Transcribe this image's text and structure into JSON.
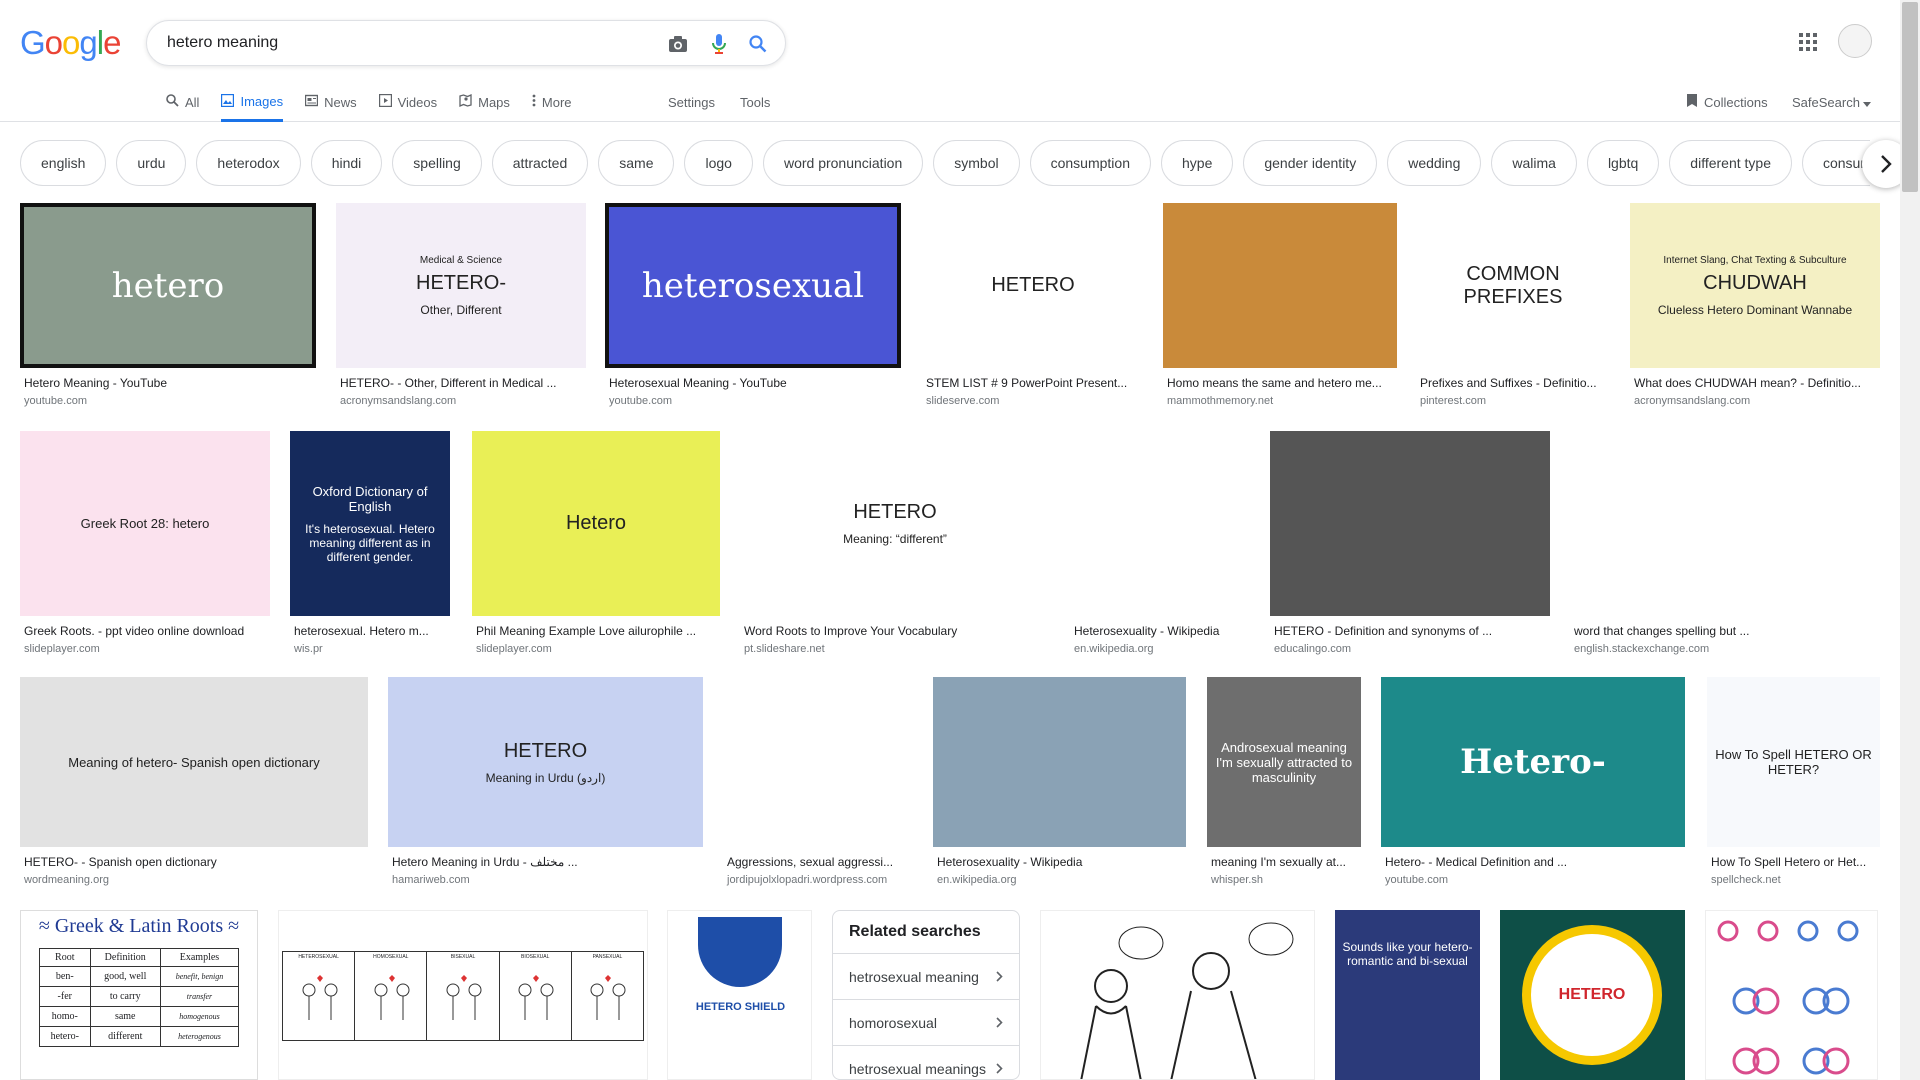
{
  "search": {
    "query": "hetero meaning"
  },
  "logo": {
    "letters": [
      "G",
      "o",
      "o",
      "g",
      "l",
      "e"
    ],
    "colors": [
      "#4285F4",
      "#EA4335",
      "#FBBC05",
      "#4285F4",
      "#34A853",
      "#EA4335"
    ]
  },
  "tabs": [
    {
      "label": "All",
      "icon": "search-icon"
    },
    {
      "label": "Images",
      "icon": "image-icon",
      "active": true
    },
    {
      "label": "News",
      "icon": "news-icon"
    },
    {
      "label": "Videos",
      "icon": "video-icon"
    },
    {
      "label": "Maps",
      "icon": "map-icon"
    },
    {
      "label": "More",
      "icon": "more-vert-icon"
    }
  ],
  "tools": {
    "settings": "Settings",
    "tools": "Tools"
  },
  "right_nav": {
    "collections": "Collections",
    "safesearch": "SafeSearch"
  },
  "chips": [
    "english",
    "urdu",
    "heterodox",
    "hindi",
    "spelling",
    "attracted",
    "same",
    "logo",
    "word pronunciation",
    "symbol",
    "consumption",
    "hype",
    "gender identity",
    "wedding",
    "walima",
    "lgbtq",
    "different type",
    "consummate"
  ],
  "results": [
    {
      "title": "Hetero Meaning - YouTube",
      "source": "youtube.com",
      "thumb_text": "hetero"
    },
    {
      "title": "HETERO- - Other, Different in Medical ...",
      "source": "acronymsandslang.com",
      "thumb_text": "HETERO-",
      "thumb_sub": "Other, Different",
      "thumb_top": "Medical & Science"
    },
    {
      "title": "Heterosexual Meaning - YouTube",
      "source": "youtube.com",
      "thumb_text": "heterosexual"
    },
    {
      "title": "STEM LIST # 9 PowerPoint Present...",
      "source": "slideserve.com",
      "thumb_text": "HETERO"
    },
    {
      "title": "Homo means the same and hetero me...",
      "source": "mammothmemory.net"
    },
    {
      "title": "Prefixes and Suffixes - Definitio...",
      "source": "pinterest.com",
      "thumb_text": "COMMON PREFIXES"
    },
    {
      "title": "What does CHUDWAH mean? - Definitio...",
      "source": "acronymsandslang.com",
      "thumb_text": "CHUDWAH",
      "thumb_sub": "Clueless Hetero Dominant Wannabe",
      "thumb_top": "Internet Slang, Chat Texting & Subculture"
    },
    {
      "title": "Greek Roots. - ppt video online download",
      "source": "slideplayer.com",
      "thumb_text": "Greek Root 28: hetero"
    },
    {
      "title": "heterosexual. Hetero m...",
      "source": "wis.pr",
      "thumb_text": "Oxford Dictionary of English",
      "thumb_sub": "It's heterosexual. Hetero meaning different as in different gender."
    },
    {
      "title": "Phil Meaning Example Love ailurophile ...",
      "source": "slideplayer.com",
      "thumb_text": "Hetero"
    },
    {
      "title": "Word Roots to Improve Your Vocabulary",
      "source": "pt.slideshare.net",
      "thumb_text": "HETERO",
      "thumb_sub": "Meaning: “different”"
    },
    {
      "title": "Heterosexuality - Wikipedia",
      "source": "en.wikipedia.org"
    },
    {
      "title": "HETERO - Definition and synonyms of ...",
      "source": "educalingo.com"
    },
    {
      "title": "word that changes spelling but ...",
      "source": "english.stackexchange.com"
    },
    {
      "title": "HETERO- - Spanish open dictionary",
      "source": "wordmeaning.org",
      "thumb_text": "Meaning of hetero- Spanish open dictionary"
    },
    {
      "title": "Hetero Meaning in Urdu - مختلف ...",
      "source": "hamariweb.com",
      "thumb_text": "HETERO",
      "thumb_sub": "Meaning in Urdu (اردو)"
    },
    {
      "title": "Aggressions, sexual aggressi...",
      "source": "jordipujolxlopadri.wordpress.com"
    },
    {
      "title": "Heterosexuality - Wikipedia",
      "source": "en.wikipedia.org"
    },
    {
      "title": "meaning I'm sexually at...",
      "source": "whisper.sh",
      "thumb_text": "Androsexual meaning I'm sexually attracted to masculinity"
    },
    {
      "title": "Hetero- - Medical Definition and ...",
      "source": "youtube.com",
      "thumb_text": "Hetero-"
    },
    {
      "title": "How To Spell Hetero or Het...",
      "source": "spellcheck.net",
      "thumb_text": "How To Spell HETERO OR HETER?"
    }
  ],
  "row4": {
    "greek_title": "≈ Greek & Latin Roots ≈",
    "greek_cols": [
      "Root",
      "Definition",
      "Examples"
    ],
    "greek_rows": [
      [
        "ben-",
        "good, well",
        "benefit, benign"
      ],
      [
        "-fer",
        "to carry",
        "transfer"
      ],
      [
        "homo-",
        "same",
        "homogenous"
      ],
      [
        "hetero-",
        "different",
        "heterogenous"
      ]
    ],
    "sexes_labels": [
      "HETEROSEXUAL",
      "HOMOSEXUAL",
      "BISEXUAL",
      "BIOSEXUAL",
      "PANSEXUAL"
    ],
    "shield_text": "HETERO SHIELD",
    "hetero_logo": "HETERO",
    "sex_text": "Sounds like your hetero-romantic and bi-sexual"
  },
  "related_searches": {
    "title": "Related searches",
    "items": [
      "hetrosexual meaning",
      "homorosexual",
      "hetrosexual meanings"
    ]
  }
}
